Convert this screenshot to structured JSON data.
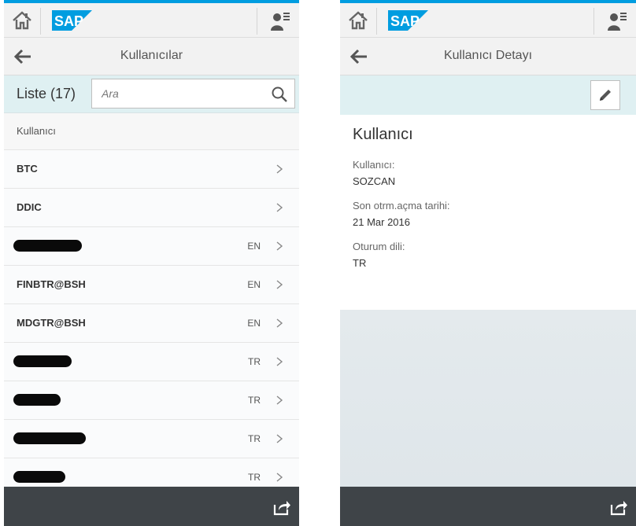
{
  "shell": {
    "home_icon": "home-icon",
    "logo_text": "SAP",
    "user_icon": "user-menu-icon",
    "brand_color": "#009de0"
  },
  "left": {
    "nav_title": "Kullanıcılar",
    "list_title": "Liste (17)",
    "search_placeholder": "Ara",
    "group_header": "Kullanıcı",
    "items": [
      {
        "title": "BTC",
        "lang": ""
      },
      {
        "title": "DDIC",
        "lang": ""
      },
      {
        "title": "",
        "lang": "EN"
      },
      {
        "title": "FINBTR@BSH",
        "lang": "EN"
      },
      {
        "title": "MDGTR@BSH",
        "lang": "EN"
      },
      {
        "title": "",
        "lang": "TR"
      },
      {
        "title": "",
        "lang": "TR"
      },
      {
        "title": "",
        "lang": "TR"
      },
      {
        "title": "",
        "lang": "TR"
      }
    ]
  },
  "right": {
    "nav_title": "Kullanıcı Detayı",
    "form_title": "Kullanıcı",
    "fields": [
      {
        "label": "Kullanıcı:",
        "value": "SOZCAN"
      },
      {
        "label": "Son otrm.açma tarihi:",
        "value": "21 Mar 2016"
      },
      {
        "label": "Oturum dili:",
        "value": "TR"
      }
    ]
  },
  "footer": {
    "share_icon": "share-icon"
  }
}
